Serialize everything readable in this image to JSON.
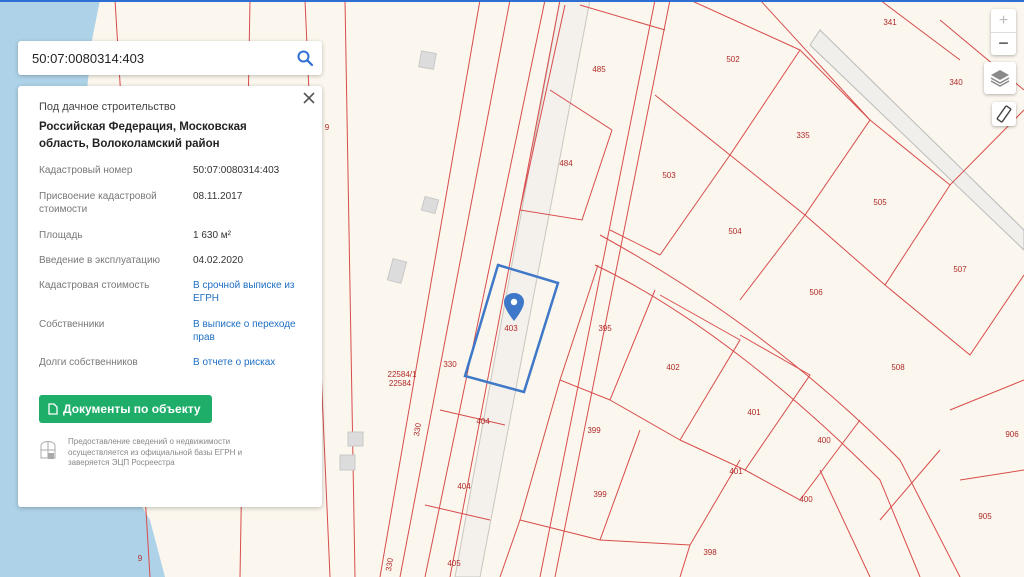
{
  "search": {
    "value": "50:07:0080314:403"
  },
  "card": {
    "type": "Под дачное строительство",
    "address": "Российская Федерация, Московская область, Волоколамский район",
    "rows": [
      {
        "key": "Кадастровый номер",
        "value": "50:07:0080314:403"
      },
      {
        "key": "Присвоение кадастровой стоимости",
        "value": "08.11.2017"
      },
      {
        "key": "Площадь",
        "value": "1 630 м²"
      },
      {
        "key": "Введение в эксплуатацию",
        "value": "04.02.2020"
      },
      {
        "key": "Кадастровая стоимость",
        "value": "В срочной выписке из ЕГРН"
      },
      {
        "key": "Собственники",
        "value": "В выписке о переходе прав"
      },
      {
        "key": "Долги собственников",
        "value": "В отчете о рисках"
      }
    ],
    "doc_button": "Документы по объекту",
    "note": "Предоставление сведений о недвижимости осуществляется из официальной базы ЕГРН и заверяется ЭЦП Росреестра"
  },
  "controls": {
    "zoom_in": "+",
    "zoom_out": "−"
  },
  "map": {
    "selected": "403",
    "labels": [
      "485",
      "502",
      "341",
      "340",
      "335",
      "484",
      "503",
      "505",
      "504",
      "507",
      "506",
      "395",
      "402",
      "508",
      "401",
      "400",
      "399",
      "404",
      "398",
      "405",
      "906",
      "905",
      "330",
      "9",
      "22584/1",
      "22584"
    ]
  },
  "colors": {
    "accent": "#2f6fd4",
    "button": "#1fae6a",
    "boundary": "#d84c4c",
    "water": "#aed3e8"
  }
}
